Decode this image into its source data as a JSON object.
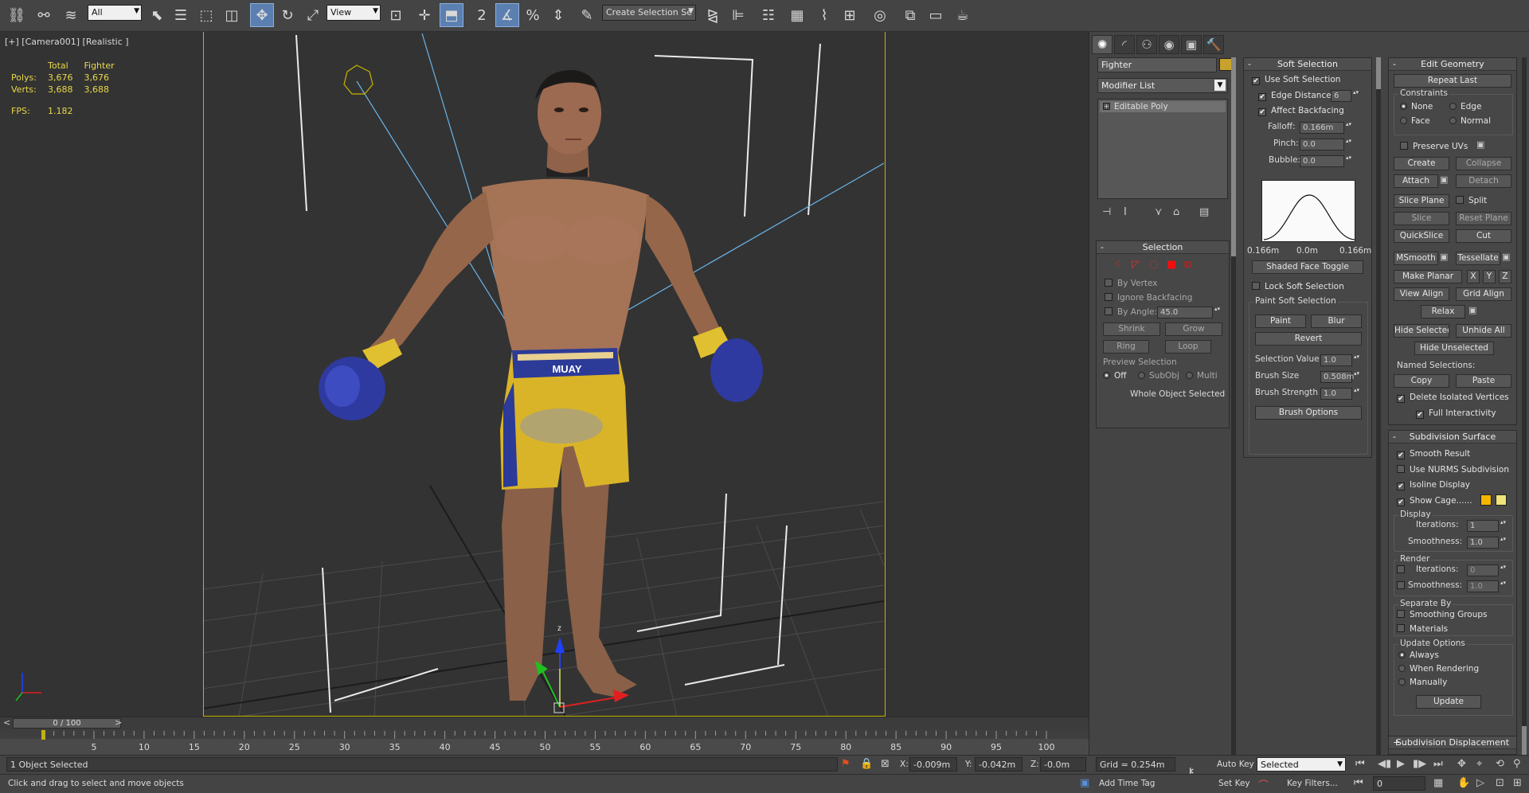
{
  "toolbar": {
    "selection_filter": "All",
    "ref_coord": "View",
    "named_selection": "Create Selection Se",
    "snap_labels": [
      "2",
      "%"
    ]
  },
  "viewport": {
    "label": "[+] [Camera001] [Realistic ]",
    "stats": {
      "col_total": "Total",
      "col_object": "Fighter",
      "polys_label": "Polys:",
      "polys_total": "3,676",
      "polys_object": "3,676",
      "verts_label": "Verts:",
      "verts_total": "3,688",
      "verts_object": "3,688",
      "fps_label": "FPS:",
      "fps_value": "1.182"
    },
    "gizmo_axis_label": "z",
    "shorts_text": "MUAY"
  },
  "command_panel": {
    "object_name": "Fighter",
    "object_color": "#c8a22c",
    "modifier_list": "Modifier List",
    "stack_item": "Editable Poly",
    "selection": {
      "title": "Selection",
      "by_vertex": "By Vertex",
      "ignore_backfacing": "Ignore Backfacing",
      "by_angle": "By Angle:",
      "angle_value": "45.0",
      "shrink": "Shrink",
      "grow": "Grow",
      "ring": "Ring",
      "loop": "Loop",
      "preview_title": "Preview Selection",
      "preview_off": "Off",
      "preview_subobj": "SubObj",
      "preview_multi": "Multi",
      "status": "Whole Object Selected"
    },
    "soft_selection": {
      "title": "Soft Selection",
      "use_soft": "Use Soft Selection",
      "edge_distance": "Edge Distance:",
      "edge_distance_value": "6",
      "affect_backfacing": "Affect Backfacing",
      "falloff_label": "Falloff:",
      "falloff_value": "0.166m",
      "pinch_label": "Pinch:",
      "pinch_value": "0.0",
      "bubble_label": "Bubble:",
      "bubble_value": "0.0",
      "curve_left": "0.166m",
      "curve_mid": "0.0m",
      "curve_right": "0.166m",
      "shaded_face_toggle": "Shaded Face Toggle",
      "lock_soft": "Lock Soft Selection",
      "paint_title": "Paint Soft Selection",
      "paint": "Paint",
      "blur": "Blur",
      "revert": "Revert",
      "selection_value_label": "Selection Value",
      "selection_value": "1.0",
      "brush_size_label": "Brush Size",
      "brush_size": "0.508m",
      "brush_strength_label": "Brush Strength",
      "brush_strength": "1.0",
      "brush_options": "Brush Options"
    },
    "edit_geometry": {
      "title": "Edit Geometry",
      "repeat_last": "Repeat Last",
      "constraints": "Constraints",
      "none": "None",
      "edge": "Edge",
      "face": "Face",
      "normal": "Normal",
      "preserve_uvs": "Preserve UVs",
      "create": "Create",
      "collapse": "Collapse",
      "attach": "Attach",
      "detach": "Detach",
      "slice_plane": "Slice Plane",
      "split": "Split",
      "slice": "Slice",
      "reset_plane": "Reset Plane",
      "quickslice": "QuickSlice",
      "cut": "Cut",
      "msmooth": "MSmooth",
      "tessellate": "Tessellate",
      "make_planar": "Make Planar",
      "x": "X",
      "y": "Y",
      "z": "Z",
      "view_align": "View Align",
      "grid_align": "Grid Align",
      "relax": "Relax",
      "hide_selected": "Hide Selected",
      "unhide_all": "Unhide All",
      "hide_unselected": "Hide Unselected",
      "named_selections": "Named Selections:",
      "copy": "Copy",
      "paste": "Paste",
      "delete_isolated": "Delete Isolated Vertices",
      "full_interactivity": "Full Interactivity"
    },
    "subdivision_surface": {
      "title": "Subdivision Surface",
      "smooth_result": "Smooth Result",
      "use_nurms": "Use NURMS Subdivision",
      "isoline_display": "Isoline Display",
      "show_cage": "Show Cage......",
      "cage_color1": "#f5b800",
      "cage_color2": "#f0e27a",
      "display": "Display",
      "iterations_label": "Iterations:",
      "display_iterations": "1",
      "smoothness_label": "Smoothness:",
      "display_smoothness": "1.0",
      "render": "Render",
      "render_iterations": "0",
      "render_smoothness": "1.0",
      "separate_by": "Separate By",
      "smoothing_groups": "Smoothing Groups",
      "materials": "Materials",
      "update_options": "Update Options",
      "always": "Always",
      "when_rendering": "When Rendering",
      "manually": "Manually",
      "update": "Update"
    },
    "subdivision_displacement": "Subdivision Displacement"
  },
  "timeline": {
    "frame_display": "0 / 100",
    "prev": "<",
    "next": ">",
    "ticks": [
      "5",
      "10",
      "15",
      "20",
      "25",
      "30",
      "35",
      "40",
      "45",
      "50",
      "55",
      "60",
      "65",
      "70",
      "75",
      "80",
      "85",
      "90",
      "95",
      "100"
    ]
  },
  "status": {
    "selection_info": "1 Object Selected",
    "prompt": "Click and drag to select and move objects",
    "x_label": "X:",
    "x_value": "-0.009m",
    "y_label": "Y:",
    "y_value": "-0.042m",
    "z_label": "Z:",
    "z_value": "-0.0m",
    "grid": "Grid = 0.254m",
    "add_time_tag": "Add Time Tag",
    "auto_key": "Auto Key",
    "set_key": "Set Key",
    "key_mode": "Selected",
    "key_filters": "Key Filters...",
    "frame": "0"
  }
}
